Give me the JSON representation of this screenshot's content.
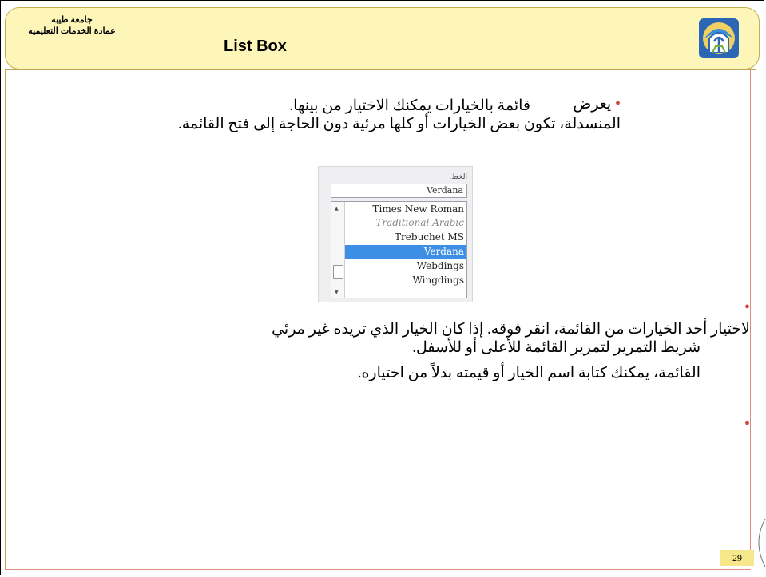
{
  "header": {
    "university": "جامعة طيبه",
    "deanship": "عمادة الخدمات التعليميه",
    "title": "List Box"
  },
  "colors": {
    "header_fill": "#fdf6b8",
    "header_border": "#c2ad52",
    "bullet": "#d0453a",
    "selection": "#3d8fe6",
    "page_number_fill": "#f6e78a"
  },
  "body": {
    "paragraph1_line1_word": "يعرض",
    "paragraph1_line1_rest": "قائمة بالخيارات يمكنك الاختيار من بينها.",
    "paragraph1_line2": "المنسدلة، تكون بعض الخيارات أو كلها مرئية دون الحاجة إلى فتح القائمة.",
    "paragraph2_line1": "لاختيار أحد الخيارات من القائمة، انقر فوقه. إذا كان الخيار الذي تريده غير مرئي",
    "paragraph2_line2": "شريط التمرير لتمرير القائمة للأعلى أو للأسفل.",
    "paragraph2_line3": "القائمة، يمكنك كتابة اسم الخيار أو قيمته بدلاً من اختياره."
  },
  "listbox": {
    "caption": "الخط:",
    "field_value": "Verdana",
    "items": [
      "Times New Roman",
      "Traditional Arabic",
      "Trebuchet MS",
      "Verdana",
      "Webdings",
      "Wingdings"
    ],
    "selected": "Verdana"
  },
  "footer": {
    "page_number": "29"
  }
}
